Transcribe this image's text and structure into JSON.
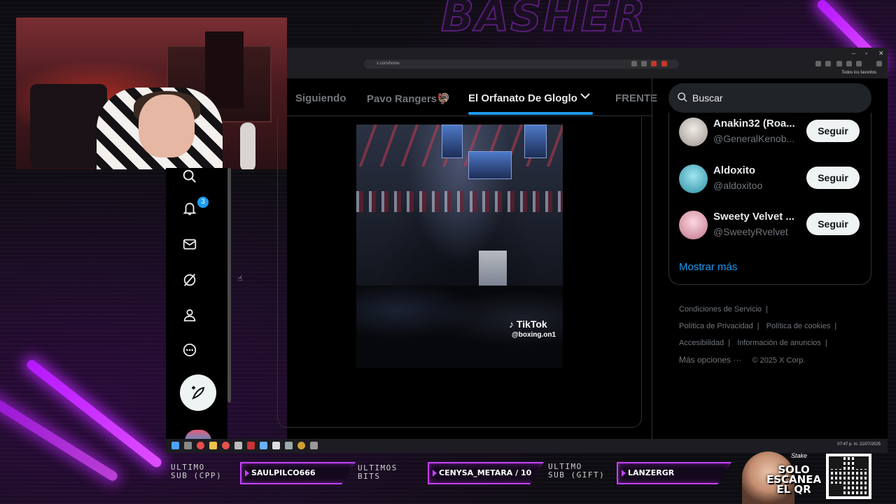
{
  "overlay": {
    "brand_text": "BASHER",
    "last_sub_label": "ULTIMO\nSUB (CPP)",
    "last_sub_value": "SAULPILCO666",
    "last_bits_label": "ULTIMOS\nBITS",
    "last_bits_value": "CENYSA_METARA / 10",
    "last_gift_label": "ULTIMO\nSUB (GIFT)",
    "last_gift_value": "LANZERGR",
    "promo_small": "Stake",
    "promo_text": "SOLO\nESCANEA\nEL QR"
  },
  "browser": {
    "url": "x.com/home",
    "favorites_label": "Todos los favoritos"
  },
  "x_app": {
    "notification_count": "3",
    "tabs": [
      {
        "label": "Siguiendo",
        "active": false
      },
      {
        "label": "Pavo Rangers🦃",
        "active": false
      },
      {
        "label": "El Orfanato De Gloglo",
        "active": true
      },
      {
        "label": "FRENTE",
        "active": false
      }
    ],
    "tab_dropdown_icon": "chevron-down-icon",
    "video_watermark": {
      "brand": "TikTok",
      "handle": "@boxing.on1"
    },
    "search_placeholder": "Buscar",
    "who_to_follow": [
      {
        "name": "Anakin32 (Roa...",
        "handle": "@GeneralKenob...",
        "button": "Seguir",
        "avatar_color": "#d8d2cc"
      },
      {
        "name": "Aldoxito",
        "handle": "@aldoxitoo",
        "button": "Seguir",
        "avatar_color": "#58b8c8"
      },
      {
        "name": "Sweety Velvet ...",
        "handle": "@SweetyRvelvet",
        "button": "Seguir",
        "avatar_color": "#e7a9bb"
      }
    ],
    "show_more": "Mostrar más",
    "footer": {
      "terms": "Condiciones de Servicio",
      "privacy": "Política de Privacidad",
      "cookies": "Política de cookies",
      "accessibility": "Accesibilidad",
      "ads_info": "Información de anuncios",
      "more": "Más opciones ···",
      "copyright": "© 2025 X Corp."
    }
  },
  "taskbar": {
    "clock": "07:47 p. m.\n21/07/2025"
  },
  "colors": {
    "accent_blue": "#1d9bf0",
    "neon_purple": "#c640ff"
  }
}
